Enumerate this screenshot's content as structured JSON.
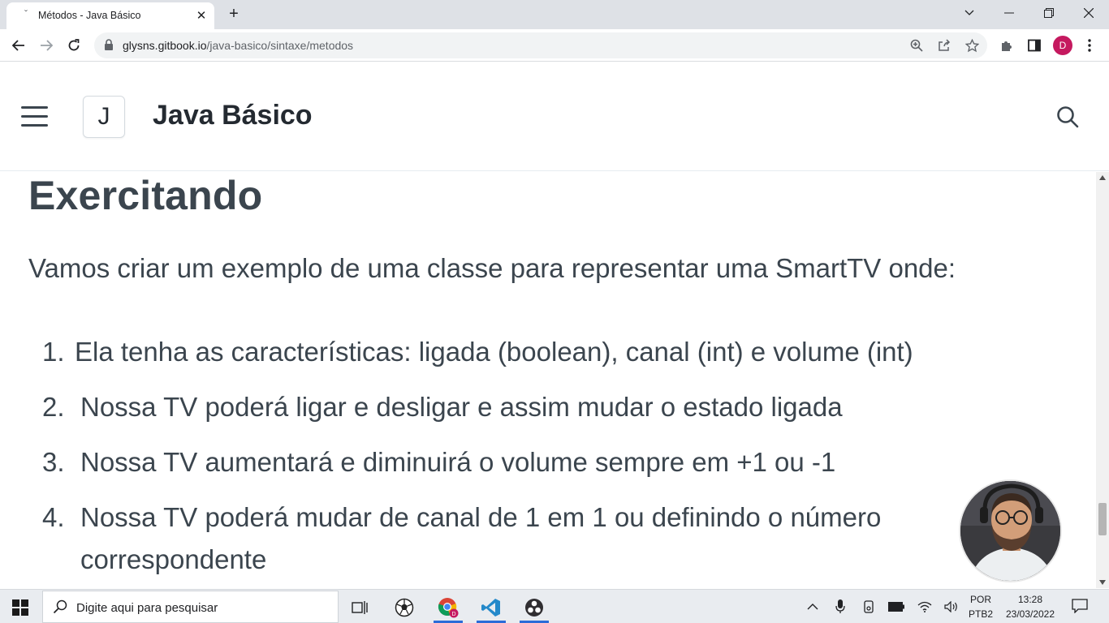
{
  "browser": {
    "tab": {
      "title": "Métodos - Java Básico"
    },
    "address": {
      "host": "glysns.gitbook.io",
      "path": "/java-basico/sintaxe/metodos"
    },
    "profile_initial": "D"
  },
  "site": {
    "logo_letter": "J",
    "title": "Java Básico"
  },
  "page": {
    "heading": "Exercitando",
    "intro": "Vamos criar um exemplo de uma classe para representar uma SmartTV onde:",
    "list": [
      {
        "num": "1.",
        "text": "Ela tenha as características: ligada (boolean), canal (int) e volume (int)"
      },
      {
        "num": "2.",
        "text": "Nossa TV poderá ligar e desligar e assim mudar o estado ligada"
      },
      {
        "num": "3.",
        "text": "Nossa TV aumentará e diminuirá o volume sempre em +1 ou -1"
      },
      {
        "num": "4.",
        "text_line1": "Nossa TV poderá mudar de canal de 1 em 1 ou definindo o número",
        "text_line2": "correspondente"
      }
    ]
  },
  "taskbar": {
    "search_placeholder": "Digite aqui para pesquisar",
    "lang_top": "POR",
    "lang_bottom": "PTB2",
    "time": "13:28",
    "date": "23/03/2022"
  },
  "icons": {
    "menu": "hamburger-icon",
    "search": "search-icon",
    "windows": "windows-start-icon"
  }
}
